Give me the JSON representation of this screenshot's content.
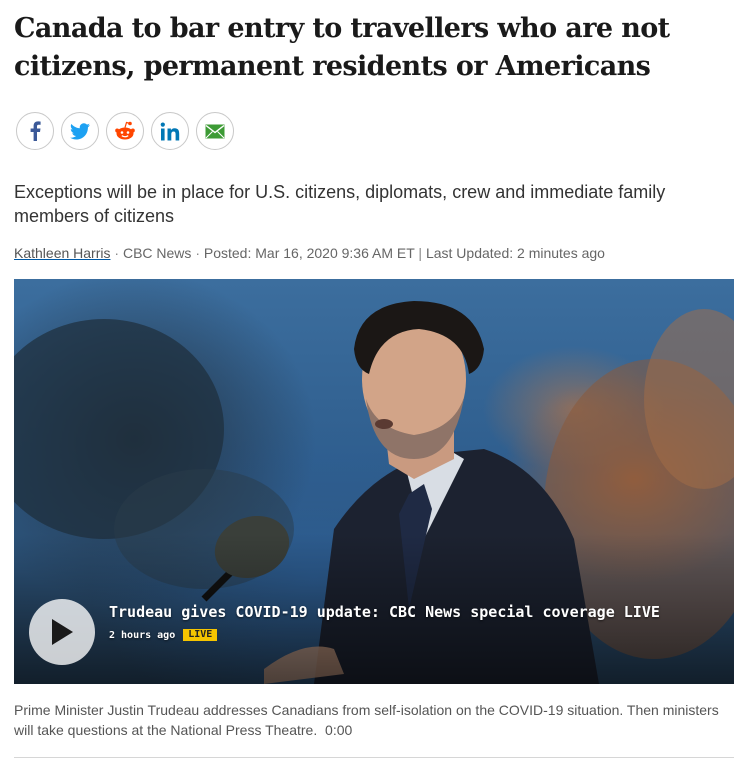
{
  "article": {
    "headline_line1": "Canada to bar entry to travellers who are not",
    "headline_line2": "citizens, permanent residents or Americans",
    "deck": "Exceptions will be in place for U.S. citizens, diplomats, crew and immediate family members of citizens",
    "byline": {
      "author": "Kathleen Harris",
      "source": "CBC News",
      "posted": "Posted: Mar 16, 2020 9:36 AM ET",
      "updated": "Last Updated: 2 minutes ago"
    }
  },
  "share": {
    "buttons": [
      {
        "name": "facebook",
        "icon": "facebook-icon",
        "color": "#3b5998"
      },
      {
        "name": "twitter",
        "icon": "twitter-icon",
        "color": "#1da1f2"
      },
      {
        "name": "reddit",
        "icon": "reddit-icon",
        "color": "#ff4500"
      },
      {
        "name": "linkedin",
        "icon": "linkedin-icon",
        "color": "#0077b5"
      },
      {
        "name": "email",
        "icon": "envelope-icon",
        "color": "#3d9b35"
      }
    ]
  },
  "video": {
    "title": "Trudeau gives COVID-19 update: CBC News special coverage LIVE",
    "time_ago": "2 hours ago",
    "badge": "LIVE",
    "badge_color": "#f5c400",
    "caption": "Prime Minister Justin Trudeau addresses Canadians from self-isolation on the COVID-19 situation. Then ministers will take questions at the National Press Theatre.",
    "duration": "0:00"
  }
}
